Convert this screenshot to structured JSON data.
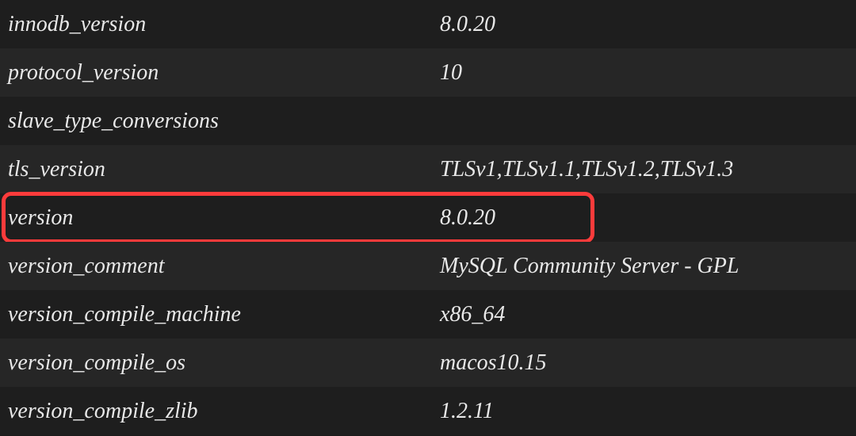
{
  "rows": [
    {
      "key": "innodb_version",
      "value": "8.0.20"
    },
    {
      "key": "protocol_version",
      "value": "10"
    },
    {
      "key": "slave_type_conversions",
      "value": ""
    },
    {
      "key": "tls_version",
      "value": "TLSv1,TLSv1.1,TLSv1.2,TLSv1.3"
    },
    {
      "key": "version",
      "value": "8.0.20"
    },
    {
      "key": "version_comment",
      "value": "MySQL Community Server - GPL"
    },
    {
      "key": "version_compile_machine",
      "value": "x86_64"
    },
    {
      "key": "version_compile_os",
      "value": "macos10.15"
    },
    {
      "key": "version_compile_zlib",
      "value": "1.2.11"
    }
  ]
}
